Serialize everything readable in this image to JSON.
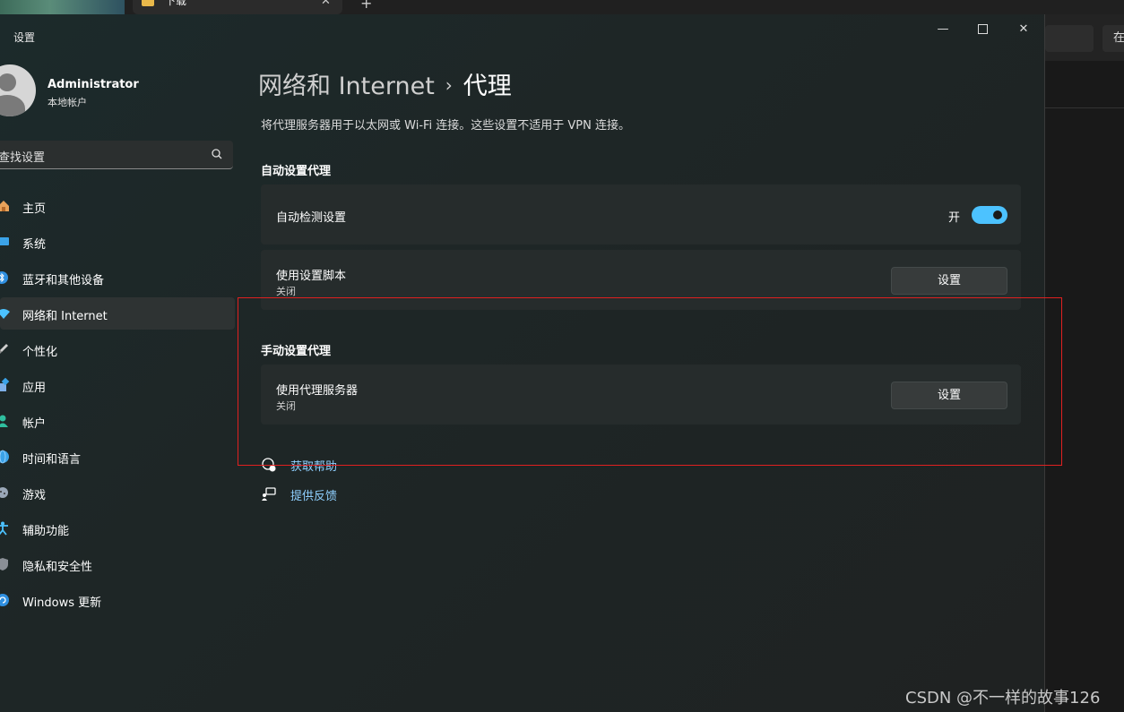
{
  "background": {
    "tab_title": "下载",
    "tab_close": "✕",
    "new_tab": "+",
    "right_button_text": "在"
  },
  "window": {
    "title": "设置",
    "minimize": "—",
    "close": "✕"
  },
  "user": {
    "name": "Administrator",
    "account_type": "本地帐户"
  },
  "search": {
    "placeholder": "查找设置"
  },
  "nav": {
    "items": [
      {
        "label": "主页",
        "icon": "home-icon"
      },
      {
        "label": "系统",
        "icon": "system-icon"
      },
      {
        "label": "蓝牙和其他设备",
        "icon": "bluetooth-icon"
      },
      {
        "label": "网络和 Internet",
        "icon": "wifi-icon",
        "selected": true
      },
      {
        "label": "个性化",
        "icon": "brush-icon"
      },
      {
        "label": "应用",
        "icon": "apps-icon"
      },
      {
        "label": "帐户",
        "icon": "account-icon"
      },
      {
        "label": "时间和语言",
        "icon": "globe-icon"
      },
      {
        "label": "游戏",
        "icon": "gamepad-icon"
      },
      {
        "label": "辅助功能",
        "icon": "accessibility-icon"
      },
      {
        "label": "隐私和安全性",
        "icon": "shield-icon"
      },
      {
        "label": "Windows 更新",
        "icon": "update-icon"
      }
    ]
  },
  "content": {
    "breadcrumb_parent": "网络和 Internet",
    "breadcrumb_separator": "›",
    "breadcrumb_current": "代理",
    "description": "将代理服务器用于以太网或 Wi-Fi 连接。这些设置不适用于 VPN 连接。",
    "auto_section_title": "自动设置代理",
    "auto_detect": {
      "title": "自动检测设置",
      "toggle_label": "开",
      "toggle_on": true
    },
    "setup_script": {
      "title": "使用设置脚本",
      "status": "关闭",
      "button": "设置"
    },
    "manual_section_title": "手动设置代理",
    "proxy_server": {
      "title": "使用代理服务器",
      "status": "关闭",
      "button": "设置"
    },
    "links": {
      "help": "获取帮助",
      "feedback": "提供反馈"
    }
  },
  "colors": {
    "accent": "#4cc2ff",
    "highlight_box": "#e02020",
    "link": "#8fd0ff"
  },
  "watermark": "CSDN @不一样的故事126"
}
